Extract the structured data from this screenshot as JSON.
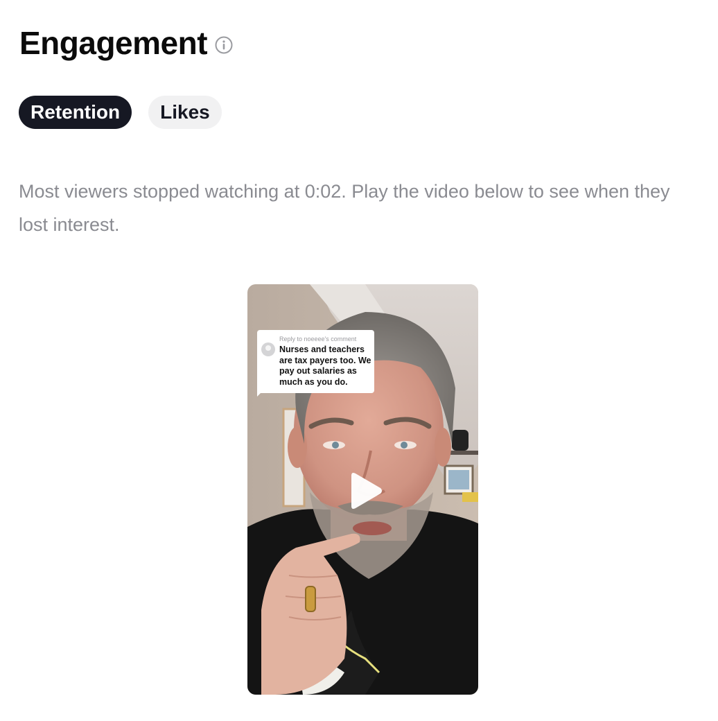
{
  "header": {
    "title": "Engagement",
    "info_icon": "info-circle-icon"
  },
  "tabs": [
    {
      "label": "Retention",
      "active": true
    },
    {
      "label": "Likes",
      "active": false
    }
  ],
  "description": "Most viewers stopped watching at 0:02. Play the video below to see when they lost interest.",
  "video": {
    "play_icon": "play-icon",
    "comment": {
      "reply_label": "Reply to noeeee's comment",
      "text": "Nurses and teachers are tax payers too. We pay out salaries as much as you do."
    }
  },
  "colors": {
    "active_tab_bg": "#161823",
    "inactive_tab_bg": "#f1f1f2",
    "description_text": "#8a8b91"
  }
}
